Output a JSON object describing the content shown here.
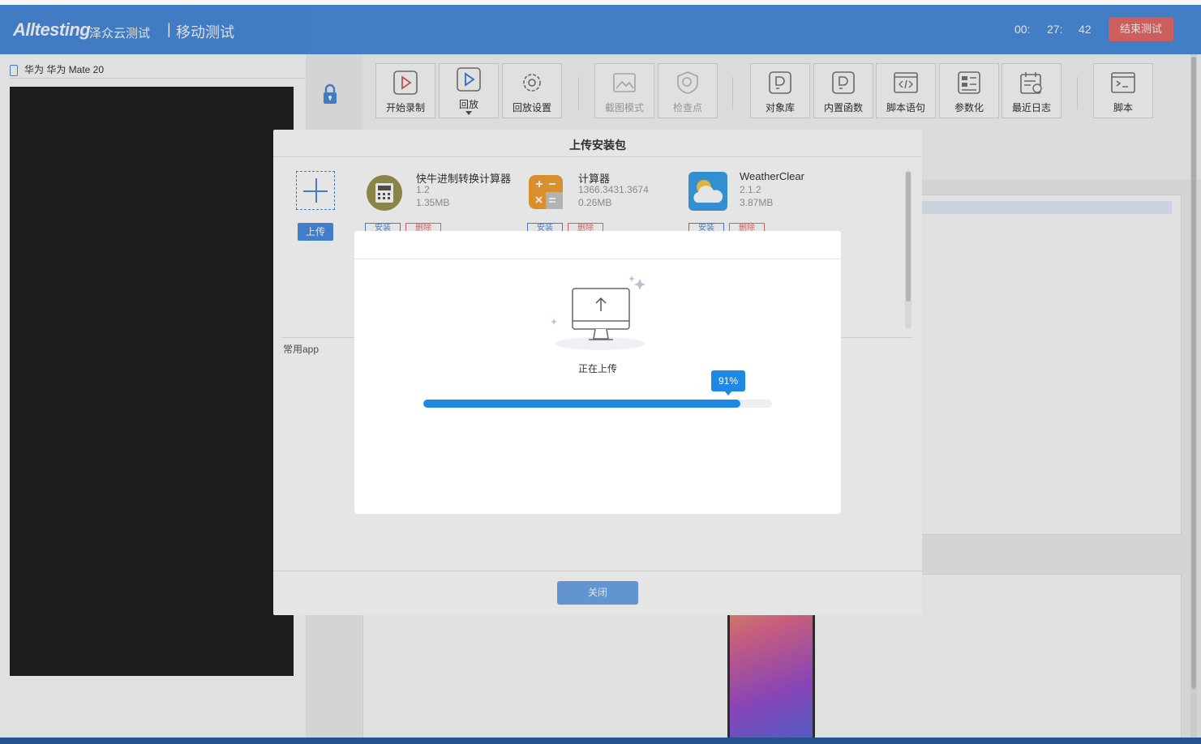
{
  "header": {
    "logo": "Alltesting",
    "logo_cn": "泽众云测试",
    "divider": "|",
    "title": "移动测试",
    "timer": {
      "h": "00:",
      "m": "27:",
      "s": "42"
    },
    "end_button": "结束测试"
  },
  "device": {
    "name": "华为 华为 Mate 20"
  },
  "toolbar": [
    {
      "label": "开始录制",
      "icon": "record-icon"
    },
    {
      "label": "回放",
      "icon": "playback-icon"
    },
    {
      "label": "回放设置",
      "icon": "gear-icon"
    },
    {
      "label": "截图模式",
      "icon": "image-icon"
    },
    {
      "label": "检查点",
      "icon": "checkpoint-icon"
    },
    {
      "label": "对象库",
      "icon": "object-library-icon"
    },
    {
      "label": "内置函数",
      "icon": "function-icon"
    },
    {
      "label": "脚本语句",
      "icon": "code-icon"
    },
    {
      "label": "参数化",
      "icon": "parameter-icon"
    },
    {
      "label": "最近日志",
      "icon": "log-icon"
    },
    {
      "label": "脚本",
      "icon": "terminal-icon"
    }
  ],
  "dialog": {
    "title": "上传安装包",
    "upload_button": "上传",
    "apps": [
      {
        "name": "快牛进制转换计算器",
        "version": "1.2",
        "size": "1.35MB",
        "icon": "calculator-icon"
      },
      {
        "name": "计算器",
        "version": "1366.3431.3674",
        "size": "0.26MB",
        "icon": "calculator-app-icon"
      },
      {
        "name": "WeatherClear",
        "version": "2.1.2",
        "size": "3.87MB",
        "icon": "weather-icon"
      }
    ],
    "install_label": "安装",
    "delete_label": "删除",
    "common_label": "常用app",
    "close_button": "关闭"
  },
  "upload_modal": {
    "status": "正在上传",
    "progress_percent": 91,
    "progress_label": "91%"
  },
  "colors": {
    "accent": "#4a8ce0",
    "danger": "#e96b6b",
    "progress": "#1e88e5"
  }
}
